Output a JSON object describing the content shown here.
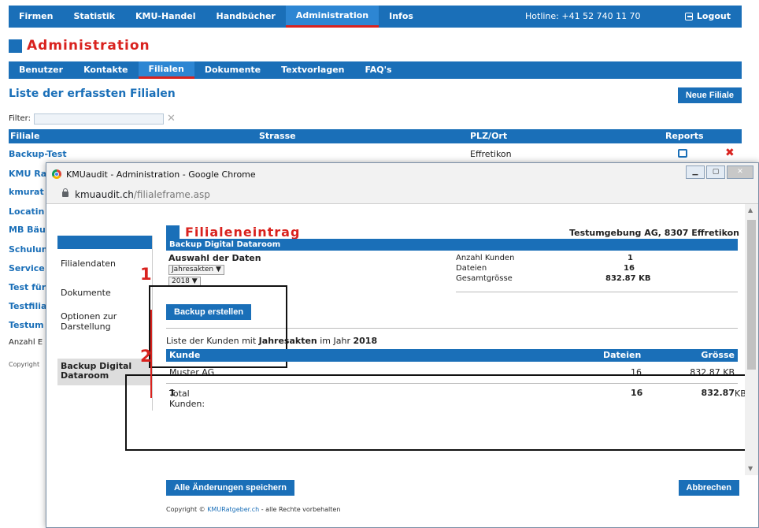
{
  "topnav": {
    "items": [
      "Firmen",
      "Statistik",
      "KMU-Handel",
      "Handbücher",
      "Administration",
      "Infos"
    ],
    "hotline": "Hotline: +41 52 740 11 70",
    "logout": "Logout"
  },
  "page_title": "Administration",
  "subnav": {
    "items": [
      "Benutzer",
      "Kontakte",
      "Filialen",
      "Dokumente",
      "Textvorlagen",
      "FAQ's"
    ]
  },
  "list": {
    "title": "Liste der erfassten Filialen",
    "new_button": "Neue Filiale",
    "filter_label": "Filter:",
    "columns": [
      "Filiale",
      "Strasse",
      "PLZ/Ort",
      "Reports"
    ],
    "rows": [
      {
        "name": "Backup-Test",
        "plz": "Effretikon"
      },
      {
        "name": "KMU Ra",
        "plz": ""
      },
      {
        "name": "kmurat",
        "plz": ""
      },
      {
        "name": "Locatin",
        "plz": ""
      },
      {
        "name": "MB Bäu",
        "plz": ""
      },
      {
        "name": "Schulun",
        "plz": ""
      },
      {
        "name": "Service",
        "plz": ""
      },
      {
        "name": "Test für",
        "plz": ""
      },
      {
        "name": "Testfilia",
        "plz": ""
      },
      {
        "name": "Testum",
        "plz": ""
      }
    ],
    "count_label": "Anzahl E",
    "copyright": "Copyright"
  },
  "popup": {
    "window_title": "KMUaudit - Administration - Google Chrome",
    "url_host": "kmuaudit.ch",
    "url_path": "/filialeframe.asp",
    "title": "Filialeneintrag",
    "company": "Testumgebung AG, 8307 Effretikon",
    "sidebar": {
      "items": [
        "Filialendaten",
        "Dokumente",
        "Optionen zur Darstellung"
      ],
      "selected": "Backup Digital Dataroom"
    },
    "section_title": "Backup Digital Dataroom",
    "selection_label": "Auswahl der Daten",
    "type_select": "Jahresakten ▼",
    "year_select": "2018 ▼",
    "stats": [
      {
        "label": "Anzahl Kunden",
        "value": "1"
      },
      {
        "label": "Dateien",
        "value": "16"
      },
      {
        "label": "Gesamtgrösse",
        "value": "832.87 KB"
      }
    ],
    "backup_button": "Backup erstellen",
    "annotation_1": "1",
    "annotation_2": "2",
    "list_text_1": "Liste der Kunden mit ",
    "list_type": "Jahresakten",
    "list_text_2": " im Jahr ",
    "list_year": "2018",
    "table": {
      "columns": [
        "Kunde",
        "Dateien",
        "Grösse"
      ],
      "rows": [
        {
          "kunde": "Muster AG",
          "dateien": "16",
          "groesse": "832.87 KB"
        }
      ],
      "total_label": "Total Kunden: ",
      "total_count": "1",
      "total_dateien": "16",
      "total_groesse": "832.87",
      "total_unit": "KB"
    },
    "save_button": "Alle Änderungen speichern",
    "cancel_button": "Abbrechen",
    "copyright_prefix": "Copyright © ",
    "copyright_link": "KMURatgeber.ch",
    "copyright_suffix": " - alle Rechte vorbehalten"
  },
  "colors": {
    "primary": "#1a6fb8",
    "accent_red": "#d9221e",
    "selected_gray": "#dddddd"
  }
}
